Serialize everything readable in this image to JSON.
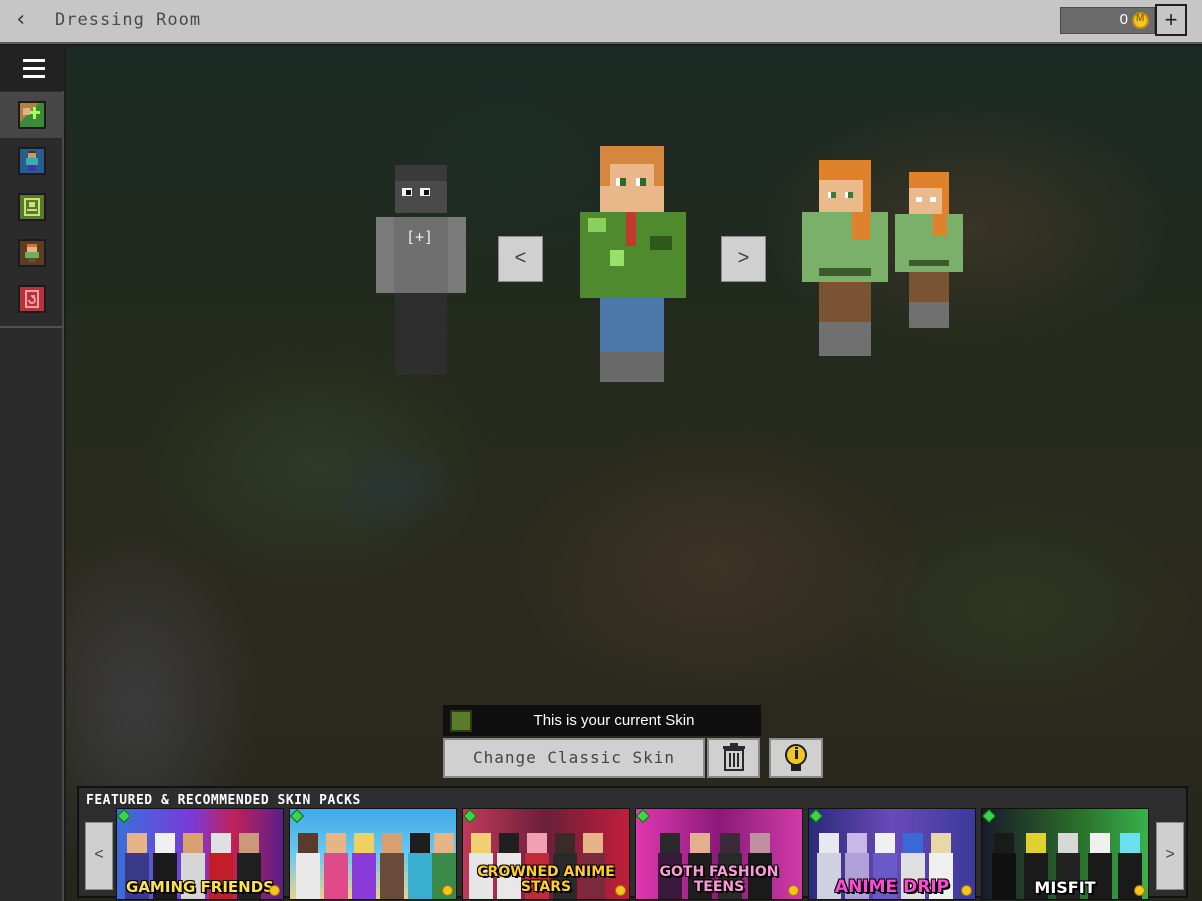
{
  "header": {
    "title": "Dressing Room",
    "coin_balance": "0"
  },
  "sidebar": {
    "items": [
      {
        "name": "create-character",
        "active": true
      },
      {
        "name": "skins",
        "active": false
      },
      {
        "name": "classic-skins",
        "active": false
      },
      {
        "name": "character-creator",
        "active": false
      },
      {
        "name": "redeem",
        "active": false
      }
    ]
  },
  "carousel": {
    "prev_label": "<",
    "next_label": ">",
    "add_slot_label": "[+]"
  },
  "current_skin": {
    "status_text": "This is your current Skin",
    "change_button_label": "Change Classic Skin"
  },
  "featured": {
    "title": "FEATURED & RECOMMENDED SKIN PACKS",
    "prev_label": "<",
    "next_label": ">",
    "packs": [
      {
        "title": "GAMING FRIENDS",
        "title_color": "#ffe14a",
        "bg": "#5a2b7a"
      },
      {
        "title": "",
        "title_color": "#ffffff",
        "bg": "#2d8fd8"
      },
      {
        "title": "CROWNED ANIME STARS",
        "title_color": "#ffcf2a",
        "bg": "#7a1f3a"
      },
      {
        "title": "GOTH FASHION TEENS",
        "title_color": "#ff7ad0",
        "bg": "#a51f8a"
      },
      {
        "title": "ANIME DRIP",
        "title_color": "#ff3fd0",
        "bg": "#3a2e8a"
      },
      {
        "title": "MISFIT",
        "title_color": "#ffffff",
        "bg": "#1f7a2e"
      }
    ]
  },
  "colors": {
    "topbar": "#c6c6c6",
    "sidebar": "#2b2b2b",
    "button_face": "#d0d0d0",
    "coin": "#f2c521"
  }
}
